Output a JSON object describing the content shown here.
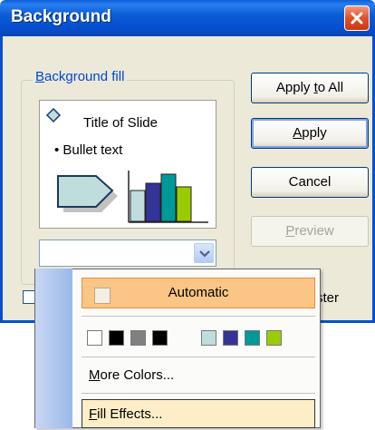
{
  "dialog": {
    "title": "Background",
    "close_icon": "close-icon"
  },
  "group": {
    "label_prefix": "",
    "label_ul": "B",
    "label_rest": "ackground fill"
  },
  "preview": {
    "title_text": "Title of Slide",
    "bullet_text": "• Bullet text"
  },
  "buttons": {
    "apply_to_all_pre": "Apply ",
    "apply_to_all_ul": "t",
    "apply_to_all_post": "o All",
    "apply_ul": "A",
    "apply_post": "pply",
    "cancel": "Cancel",
    "preview_ul": "P",
    "preview_post": "review"
  },
  "checkbox": {
    "label_visible": "ster"
  },
  "popup": {
    "automatic": "Automatic",
    "more_colors_ul": "M",
    "more_colors_post": "ore Colors...",
    "fill_effects_ul": "F",
    "fill_effects_post": "ill Effects...",
    "swatches": [
      "#ffffff",
      "#000000",
      "#808080",
      "#000000",
      "#c0dcdc",
      "#333399",
      "#009999",
      "#99cc00"
    ]
  },
  "colors": {
    "titlebar": "#0450d0",
    "dialog_bg": "#ece9d8",
    "highlight": "#fbc586",
    "hover": "#fdeec8"
  }
}
